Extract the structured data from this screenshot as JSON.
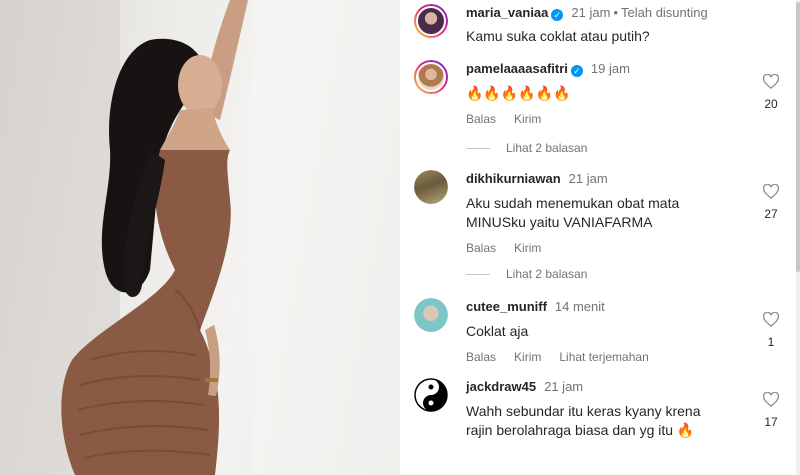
{
  "post": {
    "caption_user": "maria_vaniaa",
    "caption_time": "21 jam",
    "caption_edited": "Telah disunting",
    "caption_text": "Kamu suka coklat atau putih?"
  },
  "actions": {
    "reply": "Balas",
    "send": "Kirim",
    "translate": "Lihat terjemahan"
  },
  "comments": [
    {
      "user": "pamelaaaasafitri",
      "verified": true,
      "time": "19 jam",
      "text": "🔥🔥🔥🔥🔥🔥",
      "likes": "20",
      "replies": "Lihat 2 balasan"
    },
    {
      "user": "dikhikurniawan",
      "verified": false,
      "time": "21 jam",
      "text": "Aku sudah menemukan obat mata MINUSku yaitu VANIAFARMA",
      "likes": "27",
      "replies": "Lihat 2 balasan"
    },
    {
      "user": "cutee_muniff",
      "verified": false,
      "time": "14 menit",
      "text": "Coklat aja",
      "likes": "1"
    },
    {
      "user": "jackdraw45",
      "verified": false,
      "time": "21 jam",
      "text": "Wahh sebundar itu keras kyany krena rajin berolahraga biasa dan yg itu 🔥",
      "likes": "17"
    }
  ],
  "colors": {
    "accent": "#0095f6",
    "muted": "#737373",
    "text": "#262626",
    "dress": "#8a5a44"
  }
}
